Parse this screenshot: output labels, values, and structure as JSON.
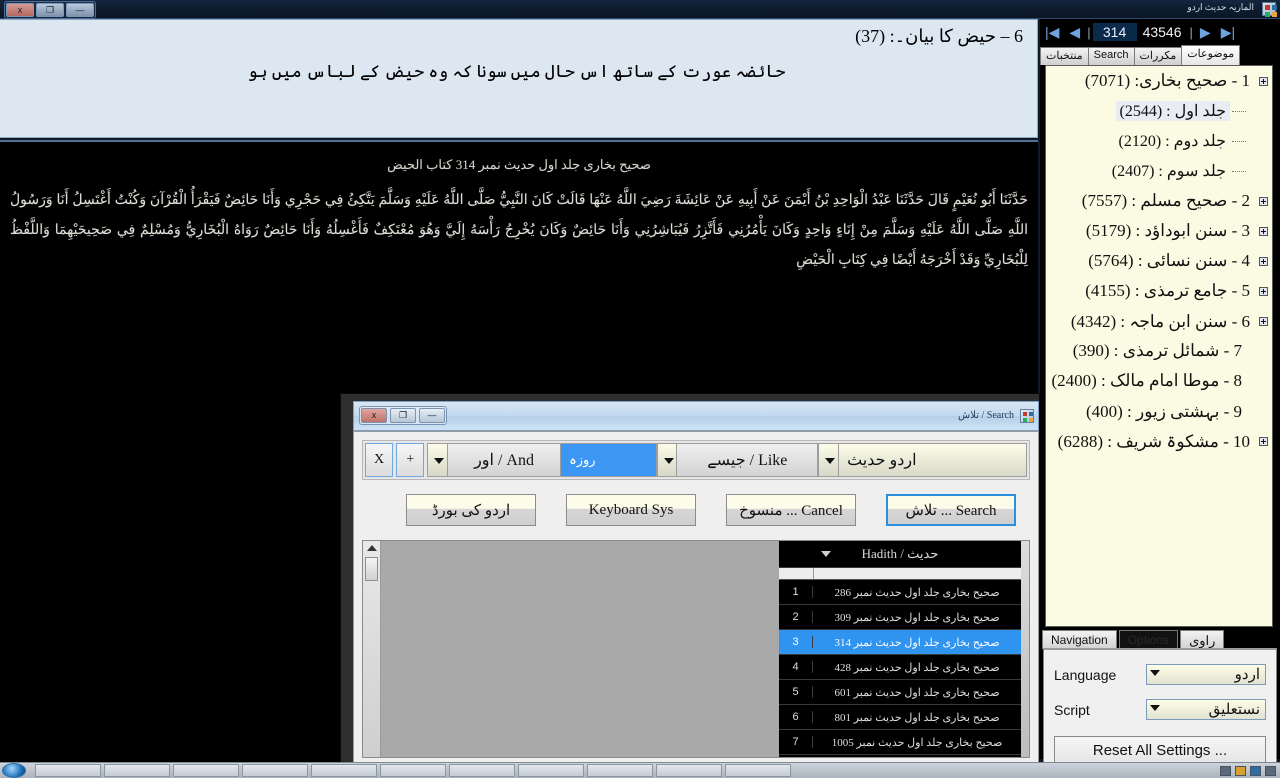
{
  "app": {
    "title": "الماريہ حديث اردو",
    "window_buttons": {
      "close": "x",
      "restore": "❐",
      "minimize": "—"
    }
  },
  "reader": {
    "chapter_heading": "6 – حیض کا بیان۔: (37)",
    "subheading": "حائضہ عورت کے ساتھ اس حال میں سونا کہ وہ حیض کے لباس میں ہو",
    "body_topline": "صحیح بخاری جلد اول حدیث نمبر 314                    کتاب الحیض",
    "body_text": "حَدَّثَنَا أَبُو نُعَيْمٍ قَالَ حَدَّثَنَا عَبْدُ الْوَاحِدِ بْنُ أَيْمَنَ عَنْ أَبِيهِ عَنْ عَائِشَةَ رَضِيَ اللَّهُ عَنْهَا قَالَتْ كَانَ النَّبِيُّ صَلَّى اللَّهُ عَلَيْهِ وَسَلَّمَ يَتَّكِئُ فِي حَجْرِي وَأَنَا حَائِضٌ فَيَقْرَأُ الْقُرْآنَ وَكُنْتُ أَغْتَسِلُ أَنَا وَرَسُولُ اللَّهِ صَلَّى اللَّهُ عَلَيْهِ وَسَلَّمَ مِنْ إِنَاءٍ وَاحِدٍ وَكَانَ يَأْمُرُنِي فَأَتَّزِرُ فَيُبَاشِرُنِي وَأَنَا حَائِضٌ وَكَانَ يُخْرِجُ رَأْسَهُ إِلَيَّ وَهُوَ مُعْتَكِفٌ فَأَغْسِلُهُ وَأَنَا حَائِضٌ رَوَاهُ الْبُخَارِيُّ وَمُسْلِمٌ فِي صَحِيحَيْهِمَا وَاللَّفْظُ لِلْبُخَارِيِّ وَقَدْ أَخْرَجَهُ أَيْضًا فِي كِتَابِ الْحَيْضِ"
  },
  "navigator": {
    "first_icon": "first-record-icon",
    "prev_icon": "previous-record-icon",
    "next_icon": "next-record-icon",
    "last_icon": "last-record-icon",
    "current_record": "314",
    "total_records": "43546",
    "separator": "|"
  },
  "sidebar_tabs": [
    {
      "label": "منتخبات",
      "rtl": true,
      "active": false
    },
    {
      "label": "Search",
      "rtl": false,
      "active": false
    },
    {
      "label": "مکررات",
      "rtl": true,
      "active": false
    },
    {
      "label": "موضوعات",
      "rtl": true,
      "active": true
    }
  ],
  "books": [
    {
      "label": "1 - صحیح بخاری: (7071)",
      "level": 0,
      "expandable": true,
      "selected": false
    },
    {
      "label": "جلد اول : (2544)",
      "level": 1,
      "expandable": false,
      "selected": true
    },
    {
      "label": "جلد دوم : (2120)",
      "level": 1,
      "expandable": false,
      "selected": false
    },
    {
      "label": "جلد سوم : (2407)",
      "level": 1,
      "expandable": false,
      "selected": false
    },
    {
      "label": "2 - صحیح مسلم : (7557)",
      "level": 0,
      "expandable": true,
      "selected": false
    },
    {
      "label": "3 - سنن ابوداؤد : (5179)",
      "level": 0,
      "expandable": true,
      "selected": false
    },
    {
      "label": "4 - سنن نسائی : (5764)",
      "level": 0,
      "expandable": true,
      "selected": false
    },
    {
      "label": "5 - جامع ترمذی : (4155)",
      "level": 0,
      "expandable": true,
      "selected": false
    },
    {
      "label": "6 - سنن ابن ماجہ : (4342)",
      "level": 0,
      "expandable": true,
      "selected": false
    },
    {
      "label": "7 - شمائل ترمذی : (390)",
      "level": 0,
      "expandable": false,
      "selected": false
    },
    {
      "label": "8 - موطا امام مالک : (2400)",
      "level": 0,
      "expandable": false,
      "selected": false
    },
    {
      "label": "9 - بہشتی زیور : (400)",
      "level": 0,
      "expandable": false,
      "selected": false
    },
    {
      "label": "10 - مشکوۃ شریف : (6288)",
      "level": 0,
      "expandable": true,
      "selected": false
    }
  ],
  "option_tabs": [
    {
      "label": "Navigation",
      "rtl": false,
      "active": false
    },
    {
      "label": "Options",
      "rtl": false,
      "active": true
    },
    {
      "label": "راوی",
      "rtl": true,
      "active": false
    }
  ],
  "options": {
    "language_label": "Language",
    "language_value": "اردو",
    "script_label": "Script",
    "script_value": "نستعلیق",
    "reset_label": "Reset All Settings ..."
  },
  "search_dialog": {
    "title": "Search / تلاش",
    "window_buttons": {
      "close": "x",
      "restore": "❐",
      "minimize": "—"
    },
    "query": {
      "remove_label": "X",
      "add_label": "+",
      "operator": "And / اور",
      "word": "روزہ",
      "match": "Like / جیسے",
      "field": "اردو حدیث"
    },
    "buttons": [
      {
        "label": "تلاش ... Search",
        "primary": true
      },
      {
        "label": "منسوخ ... Cancel",
        "primary": false
      },
      {
        "label": "Keyboard Sys",
        "primary": false
      },
      {
        "label": "اردو کی بورڈ",
        "primary": false
      }
    ],
    "grid": {
      "header": "حدیث / Hadith",
      "rows": [
        {
          "num": "1",
          "text": "صحیح بخاری جلد اول حدیث نمبر 286",
          "selected": false
        },
        {
          "num": "2",
          "text": "صحیح بخاری جلد اول حدیث نمبر 309",
          "selected": false
        },
        {
          "num": "3",
          "text": "صحیح بخاری جلد اول حدیث نمبر 314",
          "selected": true
        },
        {
          "num": "4",
          "text": "صحیح بخاری جلد اول حدیث نمبر 428",
          "selected": false
        },
        {
          "num": "5",
          "text": "صحیح بخاری جلد اول حدیث نمبر 601",
          "selected": false
        },
        {
          "num": "6",
          "text": "صحیح بخاری جلد اول حدیث نمبر 801",
          "selected": false
        },
        {
          "num": "7",
          "text": "صحیح بخاری جلد اول حدیث نمبر 1005",
          "selected": false
        }
      ]
    }
  },
  "colors": {
    "accent_blue": "#2f93f0",
    "list_cream": "#fbfbe3",
    "reader_head": "#dce7f2",
    "frame_dark": "#0e1a2b"
  }
}
